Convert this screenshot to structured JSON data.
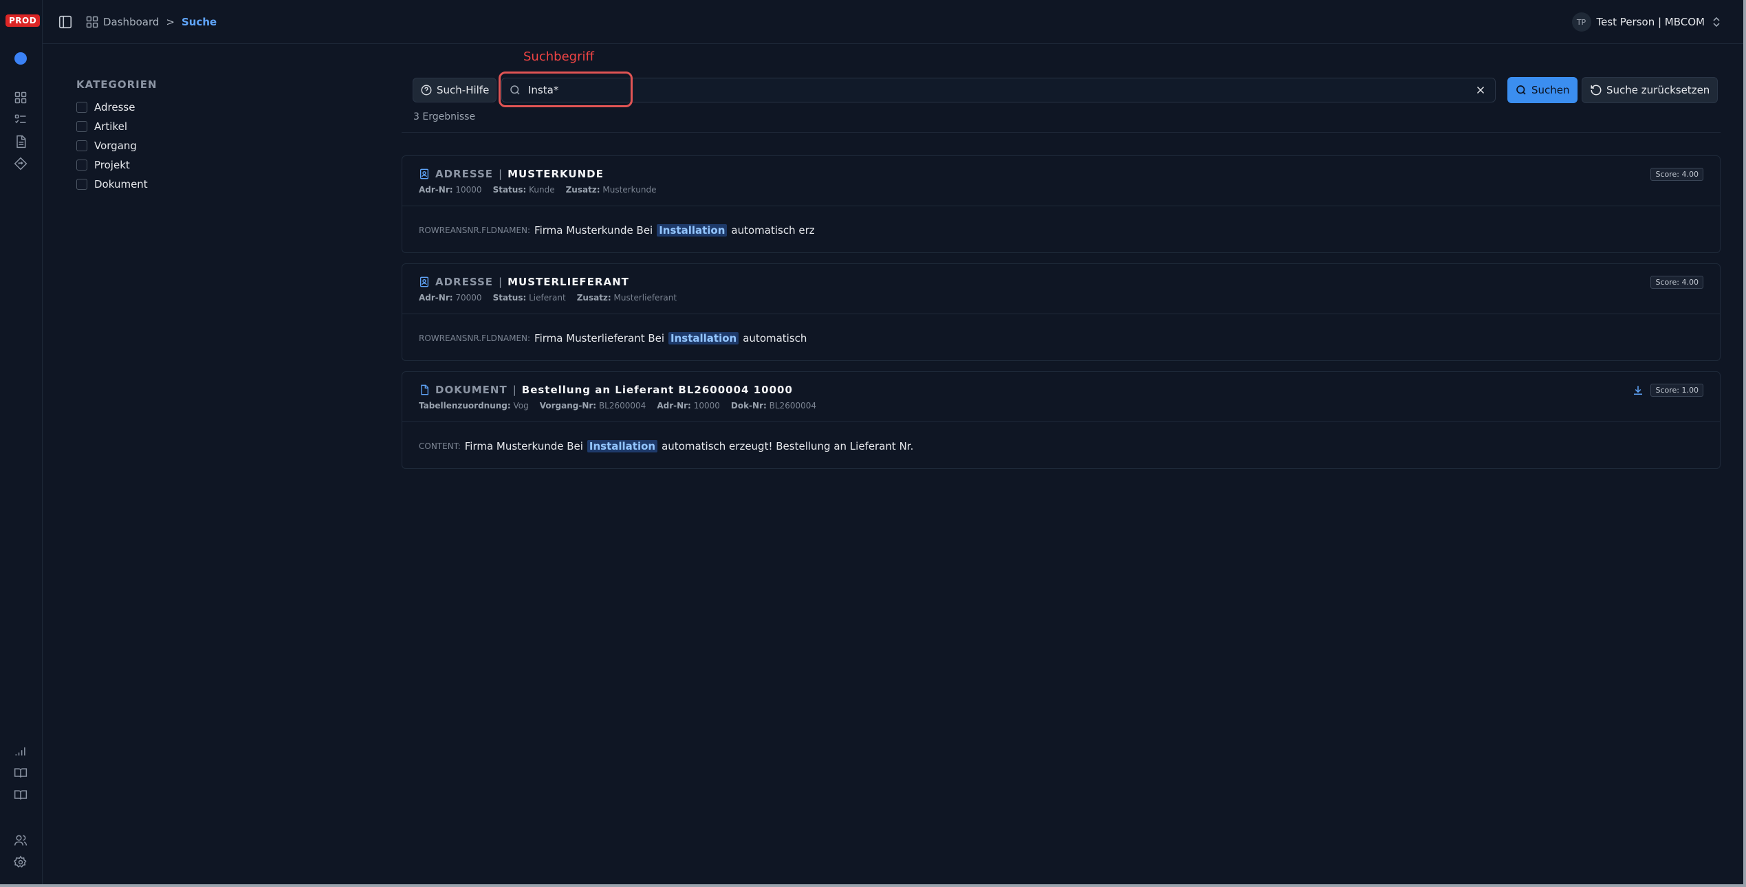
{
  "rail": {
    "badge": "PROD"
  },
  "header": {
    "breadcrumb_home": "Dashboard",
    "breadcrumb_sep": ">",
    "breadcrumb_current": "Suche",
    "user_initials": "TP",
    "user_name": "Test Person | MBCOM"
  },
  "categories": {
    "title": "KATEGORIEN",
    "items": [
      "Adresse",
      "Artikel",
      "Vorgang",
      "Projekt",
      "Dokument"
    ]
  },
  "annotation": {
    "label": "Suchbegriff"
  },
  "search": {
    "help_label": "Such-Hilfe",
    "query": "Insta*",
    "submit_label": "Suchen",
    "reset_label": "Suche zurücksetzen",
    "result_count": "3 Ergebnisse"
  },
  "results": [
    {
      "type": "ADRESSE",
      "sep": "|",
      "name": "MUSTERKUNDE",
      "meta": [
        {
          "key": "Adr-Nr:",
          "value": "10000"
        },
        {
          "key": "Status:",
          "value": "Kunde"
        },
        {
          "key": "Zusatz:",
          "value": "Musterkunde"
        }
      ],
      "score": "Score: 4.00",
      "snippet_field": "ROWREANSNR.FLDNAMEN:",
      "snippet_before": "Firma Musterkunde Bei",
      "snippet_highlight": "Installation",
      "snippet_after": "automatisch erz"
    },
    {
      "type": "ADRESSE",
      "sep": "|",
      "name": "MUSTERLIEFERANT",
      "meta": [
        {
          "key": "Adr-Nr:",
          "value": "70000"
        },
        {
          "key": "Status:",
          "value": "Lieferant"
        },
        {
          "key": "Zusatz:",
          "value": "Musterlieferant"
        }
      ],
      "score": "Score: 4.00",
      "snippet_field": "ROWREANSNR.FLDNAMEN:",
      "snippet_before": "Firma Musterlieferant Bei",
      "snippet_highlight": "Installation",
      "snippet_after": "automatisch"
    },
    {
      "type": "DOKUMENT",
      "sep": "|",
      "name": "Bestellung an Lieferant BL2600004 10000",
      "meta": [
        {
          "key": "Tabellenzuordnung:",
          "value": "Vog"
        },
        {
          "key": "Vorgang-Nr:",
          "value": "BL2600004"
        },
        {
          "key": "Adr-Nr:",
          "value": "10000"
        },
        {
          "key": "Dok-Nr:",
          "value": "BL2600004"
        }
      ],
      "score": "Score: 1.00",
      "snippet_field": "CONTENT:",
      "snippet_before": "Firma Musterkunde Bei",
      "snippet_highlight": "Installation",
      "snippet_after": "automatisch erzeugt! Bestellung an Lieferant Nr."
    }
  ]
}
